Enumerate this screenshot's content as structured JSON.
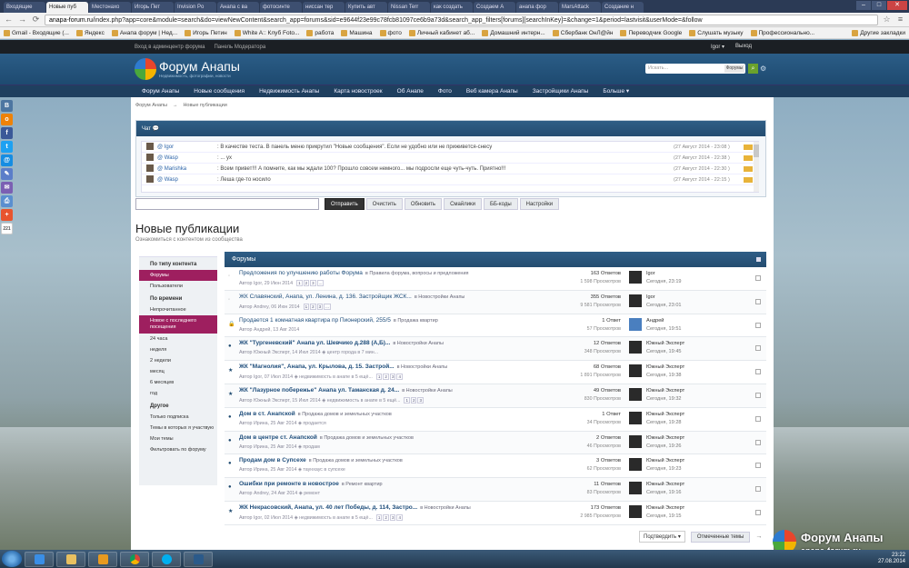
{
  "browser": {
    "tabs": [
      "Входящие",
      "Новые пуб",
      "Местонахо",
      "Игорь Пет",
      "Invision Po",
      "Анапа с ва",
      "фотосинте",
      "ниссан тер",
      "Купить авт",
      "Nissan Terr",
      "как создать",
      "Создаем А",
      "анапа фор",
      "MarsAttack",
      "Создание н"
    ],
    "active_tab": 1,
    "url_prefix": "anapa-forum.ru",
    "url_rest": "/index.php?app=core&module=search&do=viewNewContent&search_app=forums&sid=e9644f23e99c78fcb81097ce6b9a73d&search_app_filters[forums][searchInKey]=&change=1&period=lastvisit&userMode=&follow",
    "bookmarks": [
      "Gmail - Входящие (...",
      "Яндекс",
      "Анапа форум | Нед...",
      "Игорь Петин",
      "White A:: Клуб Foto...",
      "работа",
      "Машина",
      "фото",
      "Личный кабинет аб...",
      "Домашний интерн...",
      "Сбербанк ОнЛ@йн",
      "Переводчик Google",
      "Слушать музыку",
      "Профессионально..."
    ],
    "bookmarks_right": "Другие закладки"
  },
  "userbar": {
    "left": [
      "Вход в админцентр форума",
      "Панель Модератора"
    ],
    "right": [
      "Igor ▾",
      "Выход"
    ]
  },
  "header": {
    "title": "Форум Анапы",
    "subtitle": "Недвижимость, фотографии, новости",
    "search_placeholder": "Искать...",
    "search_scope": "Форумы"
  },
  "nav": [
    "Форум Анапы",
    "Новые сообщения",
    "Недвижимость Анапы",
    "Карта новостроек",
    "Об Анапе",
    "Фото",
    "Веб камера Анапы",
    "Застройщики Анапы",
    "Больше ▾"
  ],
  "social": {
    "count": "221"
  },
  "breadcrumb": [
    "Форум Анапы",
    "→",
    "Новые публикации"
  ],
  "chat": {
    "title": "Чат",
    "messages": [
      {
        "nick": "@  Igor",
        "text": ":   В качестве теста. В панель меню прикрутил \"Новые сообщения\". Если не удобно или не приживется-снесу",
        "time": "(27 Август 2014 - 23:08 )"
      },
      {
        "nick": "@  Wasp",
        "text": ":   ... ух",
        "time": "(27 Август 2014 - 22:38 )"
      },
      {
        "nick": "@  Marishka",
        "text": ":   Всем привет!!! А помните, как мы ждали 100? Прошло совсем немного... мы подросли еще чуть-чуть. Приятно!!!",
        "time": "(27 Август 2014 - 22:30 )"
      },
      {
        "nick": "@  Wasp",
        "text": ":   Леша где-то носило",
        "time": "(27 Август 2014 - 22:15 )"
      }
    ],
    "buttons": [
      "Отправить",
      "Очистить",
      "Обновить",
      "Смайлики",
      "ББ-коды",
      "Настройки"
    ]
  },
  "page": {
    "title": "Новые публикации",
    "desc": "Ознакомиться с контентом из сообщества"
  },
  "filters": {
    "g1": "По типу контента",
    "g1_items": [
      "Форумы",
      "Пользователи"
    ],
    "g2": "По времени",
    "g2_items": [
      "Непрочитанное",
      "Новое с последнего посещения",
      "24 часа",
      "неделя",
      "2 недели",
      "месяц",
      "6 месяцев",
      "год"
    ],
    "g3": "Другое",
    "g3_items": [
      "Только подписка",
      "Темы в которых я участвую",
      "Мои темы",
      "Фильтровать по форуму"
    ]
  },
  "topics": {
    "header": "Форумы",
    "rows": [
      {
        "title": "Предложения по улучшению работы Форума",
        "bold": false,
        "marker": "◦",
        "forum": "в Правила форума, вопросы и предложения",
        "meta": "Автор Igor, 29 Июн 2014",
        "pages": [
          "1",
          "2",
          "3",
          "..."
        ],
        "replies": "163 Ответов",
        "views": "1 598 Просмотров",
        "last_user": "Igor",
        "last_date": "Сегодня, 23:19",
        "av": "dark"
      },
      {
        "title": "ЖК Славянский, Анапа, ул. Ленина, д. 136. Застройщик ЖСК...",
        "bold": false,
        "marker": "◦",
        "forum": "в Новостройки Анапы",
        "meta": "Автор Andrey, 06 Июн 2014",
        "pages": [
          "1",
          "2",
          "3",
          "..."
        ],
        "replies": "355 Ответов",
        "views": "9 581 Просмотров",
        "last_user": "Igor",
        "last_date": "Сегодня, 23:01",
        "av": "dark"
      },
      {
        "title": "Продается 1 комнатная квартира пр Пионерский, 255/5",
        "bold": false,
        "marker": "🔒",
        "forum": "в Продажа квартир",
        "meta": "Автор Андрей, 13 Авг 2014",
        "pages": [],
        "replies": "1 Ответ",
        "views": "57 Просмотров",
        "last_user": "Андрей",
        "last_date": "Сегодня, 19:51",
        "av": "blue"
      },
      {
        "title": "ЖК \"Тургеневский\" Анапа ул. Шевчико д.288 (А,Б)...",
        "bold": true,
        "marker": "●",
        "forum": "в Новостройки Анапы",
        "meta": "Автор Южный Эксперт, 14 Июл 2014  ◈ центр города в 7 мин...",
        "pages": [],
        "replies": "12 Ответов",
        "views": "348 Просмотров",
        "last_user": "Южный Эксперт",
        "last_date": "Сегодня, 19:45",
        "av": "dark"
      },
      {
        "title": "ЖК \"Магнолия\", Анапа, ул. Крылова, д. 15. Застрой...",
        "bold": true,
        "marker": "★",
        "forum": "в Новостройки Анапы",
        "meta": "Автор Igor, 07 Июл 2014  ◈ недвижимость в анапе в 5 ещё...",
        "pages": [
          "1",
          "2",
          "3",
          "4"
        ],
        "replies": "68 Ответов",
        "views": "1 891 Просмотров",
        "last_user": "Южный Эксперт",
        "last_date": "Сегодня, 19:38",
        "av": "dark"
      },
      {
        "title": "ЖК \"Лазурное побережье\" Анапа ул. Таманская д. 24...",
        "bold": true,
        "marker": "★",
        "forum": "в Новостройки Анапы",
        "meta": "Автор Южный Эксперт, 15 Июл 2014  ◈ недвижимость в анапе в 5 ещё...",
        "pages": [
          "1",
          "2",
          "3"
        ],
        "replies": "49 Ответов",
        "views": "830 Просмотров",
        "last_user": "Южный Эксперт",
        "last_date": "Сегодня, 19:32",
        "av": "dark"
      },
      {
        "title": "Дом в ст. Анапской",
        "bold": true,
        "marker": "●",
        "forum": "в Продажа домов и земельных участков",
        "meta": "Автор Ирина, 25 Авг 2014  ◈ продается",
        "pages": [],
        "replies": "1 Ответ",
        "views": "34 Просмотров",
        "last_user": "Южный Эксперт",
        "last_date": "Сегодня, 19:28",
        "av": "dark"
      },
      {
        "title": "Дом в центре ст. Анапской",
        "bold": true,
        "marker": "●",
        "forum": "в Продажа домов и земельных участков",
        "meta": "Автор Ирина, 25 Авг 2014  ◈ продам",
        "pages": [],
        "replies": "2 Ответов",
        "views": "46 Просмотров",
        "last_user": "Южный Эксперт",
        "last_date": "Сегодня, 19:26",
        "av": "dark"
      },
      {
        "title": "Продам дом в Супсехе",
        "bold": true,
        "marker": "●",
        "forum": "в Продажа домов и земельных участков",
        "meta": "Автор Ирина, 25 Авг 2014  ◈ таунхаус в супсехе",
        "pages": [],
        "replies": "3 Ответов",
        "views": "62 Просмотров",
        "last_user": "Южный Эксперт",
        "last_date": "Сегодня, 19:23",
        "av": "dark"
      },
      {
        "title": "Ошибки при ремонте в новострое",
        "bold": true,
        "marker": "●",
        "forum": "в Ремонт квартир",
        "meta": "Автор Andrey, 24 Авг 2014  ◈ ремонт",
        "pages": [],
        "replies": "11 Ответов",
        "views": "83 Просмотров",
        "last_user": "Южный Эксперт",
        "last_date": "Сегодня, 19:16",
        "av": "dark"
      },
      {
        "title": "ЖК Некрасовский, Анапа, ул. 40 лет Победы, д. 114, Застро...",
        "bold": true,
        "marker": "★",
        "forum": "в Новостройки Анапы",
        "meta": "Автор Igor, 02 Июл 2014  ◈ недвижимость в анапе в 5 ещё...",
        "pages": [
          "1",
          "2",
          "3",
          "4"
        ],
        "replies": "173 Ответов",
        "views": "2 985 Просмотров",
        "last_user": "Южный Эксперт",
        "last_date": "Сегодня, 19:15",
        "av": "dark"
      }
    ]
  },
  "bottom": {
    "moderate": "Подтвердить ▾",
    "marked": "Отмеченные темы",
    "arrow": "→"
  },
  "watermark": {
    "title": "Форум Анапы",
    "site": "anapa-forum.ru"
  },
  "tray": {
    "time": "23:22",
    "date": "27.08.2014"
  }
}
